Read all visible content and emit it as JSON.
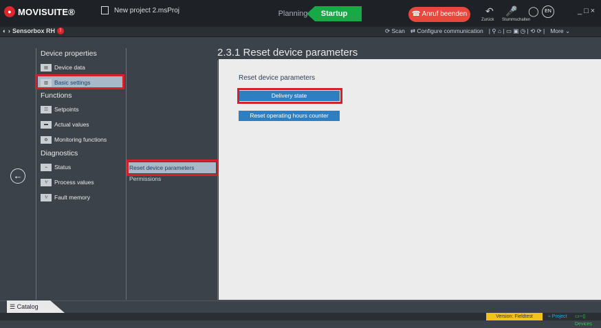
{
  "app": {
    "title": "MOVISUITE®",
    "project_name": "New project 2.msProj"
  },
  "modes": {
    "planning": "Planning",
    "startup": "Startup"
  },
  "call": {
    "label": "Anruf beenden"
  },
  "titlebar_small": {
    "back": "Zurück",
    "mute": "Stummschalten",
    "lang": "EN"
  },
  "breadcrumb": {
    "device": "Sensorbox RH"
  },
  "toolbar": {
    "scan": "Scan",
    "configure": "Configure communication",
    "more": "More"
  },
  "nav": {
    "groups": [
      {
        "label": "Device properties"
      },
      {
        "label": "Functions"
      },
      {
        "label": "Diagnostics"
      }
    ],
    "items": [
      {
        "label": "Device data",
        "icon": "device-data-icon"
      },
      {
        "label": "Basic settings",
        "icon": "basic-settings-icon",
        "selected": true
      },
      {
        "label": "Setpoints",
        "icon": "setpoints-icon"
      },
      {
        "label": "Actual values",
        "icon": "actual-values-icon"
      },
      {
        "label": "Monitoring functions",
        "icon": "monitoring-icon"
      },
      {
        "label": "Status",
        "icon": "status-icon"
      },
      {
        "label": "Process values",
        "icon": "process-values-icon"
      },
      {
        "label": "Fault memory",
        "icon": "fault-memory-icon"
      }
    ]
  },
  "middle": {
    "items": [
      {
        "label": "Reset device parameters",
        "selected": true
      },
      {
        "label": "Permissions"
      }
    ]
  },
  "content": {
    "title": "2.3.1 Reset device parameters",
    "section": "Reset device parameters",
    "buttons": [
      {
        "label": "Delivery state"
      },
      {
        "label": "Reset operating hours counter"
      }
    ]
  },
  "bottom": {
    "catalog": "Catalog",
    "version": "Version: Fieldtest",
    "project": "Project",
    "devices": "Devices"
  },
  "colors": {
    "accent_green": "#18a846",
    "accent_blue": "#2e7fc1",
    "highlight_red": "#d4202a",
    "call_red": "#e8473b",
    "version_yellow": "#f2c21c"
  }
}
